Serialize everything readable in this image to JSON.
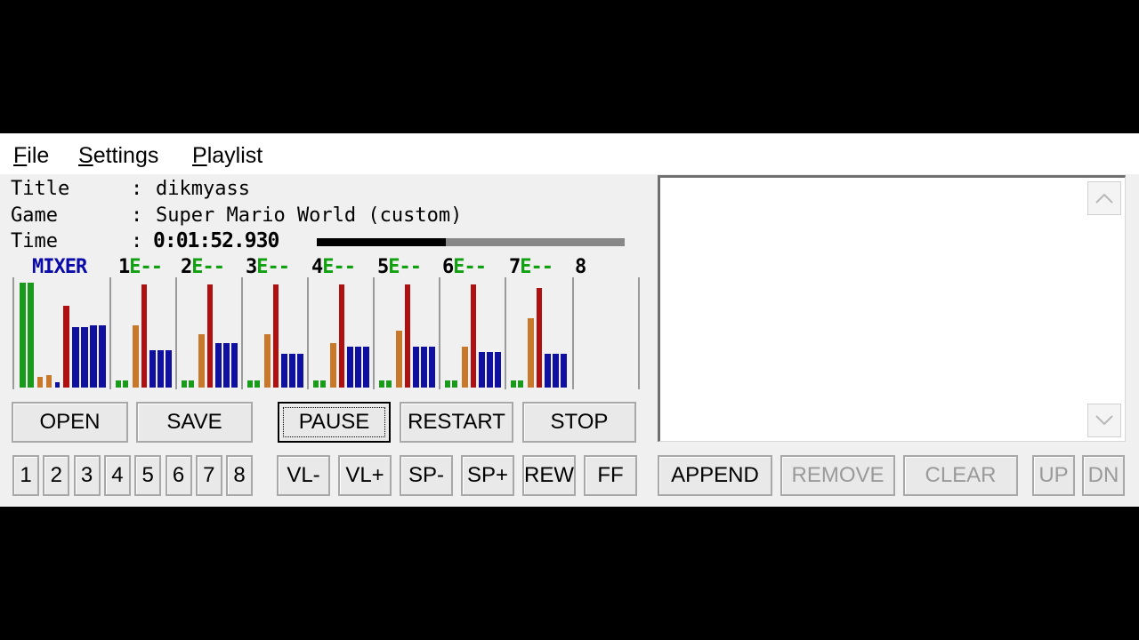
{
  "menu": {
    "file": {
      "accel": "F",
      "rest": "ile"
    },
    "settings": {
      "accel": "S",
      "rest": "ettings"
    },
    "playlist": {
      "accel": "P",
      "rest": "laylist"
    }
  },
  "info": {
    "title_label": "Title",
    "title_value": "dikmyass",
    "game_label": "Game",
    "game_value": "Super Mario World (custom)",
    "time_label": "Time",
    "time_value": "0:01:52.930",
    "colon": ":",
    "progress_fraction": 0.42
  },
  "mixer": {
    "label": "MIXER",
    "channels": [
      {
        "num": "1",
        "env": "E--"
      },
      {
        "num": "2",
        "env": "E--"
      },
      {
        "num": "3",
        "env": "E--"
      },
      {
        "num": "4",
        "env": "E--"
      },
      {
        "num": "5",
        "env": "E--"
      },
      {
        "num": "6",
        "env": "E--"
      },
      {
        "num": "7",
        "env": "E--"
      },
      {
        "num": "8",
        "env": ""
      }
    ],
    "colors": {
      "green": "#1a9a1a",
      "orange": "#c8782a",
      "red": "#b01010",
      "blue": "#1010a0"
    }
  },
  "transport": {
    "open": "OPEN",
    "save": "SAVE",
    "pause": "PAUSE",
    "restart": "RESTART",
    "stop": "STOP"
  },
  "voices": [
    "1",
    "2",
    "3",
    "4",
    "5",
    "6",
    "7",
    "8"
  ],
  "controls": {
    "vl_minus": "VL-",
    "vl_plus": "VL+",
    "sp_minus": "SP-",
    "sp_plus": "SP+",
    "rew": "REW",
    "ff": "FF"
  },
  "playlist": {
    "append": "APPEND",
    "remove": "REMOVE",
    "clear": "CLEAR",
    "up": "UP",
    "dn": "DN",
    "scroll_up_icon": "chevron-up-icon",
    "scroll_down_icon": "chevron-down-icon"
  }
}
